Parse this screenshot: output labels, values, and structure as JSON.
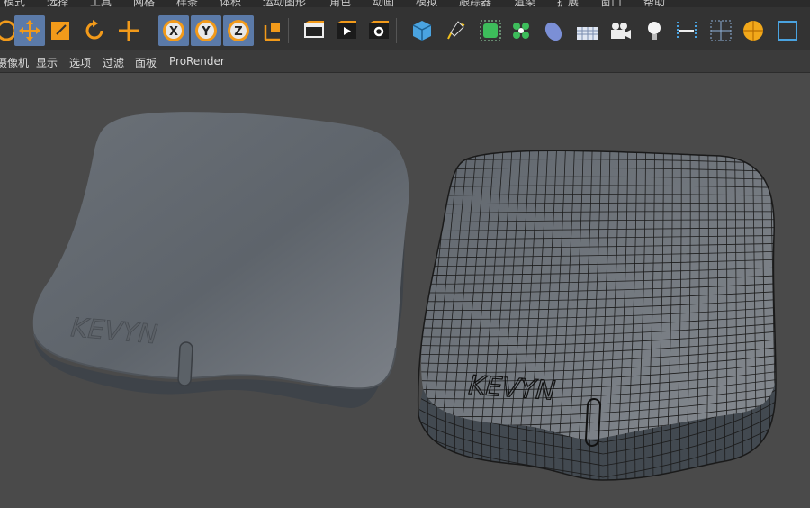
{
  "menubar": {
    "items": [
      "模式",
      "选择",
      "工具",
      "网格",
      "样条",
      "体积",
      "运动图形",
      "角色",
      "动画",
      "模拟",
      "跟踪器",
      "渲染",
      "扩展",
      "窗口",
      "帮助"
    ]
  },
  "toolbar": {
    "tools": [
      {
        "icon": "live-selection-icon",
        "active": false
      },
      {
        "icon": "move-icon",
        "active": true
      },
      {
        "icon": "scale-icon",
        "active": false
      },
      {
        "icon": "rotate-icon",
        "active": false
      },
      {
        "icon": "recent-tool-icon",
        "active": false
      },
      {
        "icon": "x-axis-lock-icon",
        "label": "X",
        "active": true
      },
      {
        "icon": "y-axis-lock-icon",
        "label": "Y",
        "active": true
      },
      {
        "icon": "z-axis-lock-icon",
        "label": "Z",
        "active": true
      },
      {
        "icon": "coordinate-system-icon",
        "active": false
      },
      {
        "icon": "render-view-icon",
        "active": false
      },
      {
        "icon": "render-picture-viewer-icon",
        "active": false
      },
      {
        "icon": "render-settings-icon",
        "active": false
      },
      {
        "icon": "cube-icon",
        "active": false
      },
      {
        "icon": "pen-spline-icon",
        "active": false
      },
      {
        "icon": "subdivision-surface-icon",
        "active": false
      },
      {
        "icon": "cloner-icon",
        "active": false
      },
      {
        "icon": "deformer-icon",
        "active": false
      },
      {
        "icon": "floor-icon",
        "active": false
      },
      {
        "icon": "camera-icon",
        "active": false
      },
      {
        "icon": "light-icon",
        "active": false
      },
      {
        "icon": "measure-icon",
        "active": false
      },
      {
        "icon": "grid-object-icon",
        "active": false
      },
      {
        "icon": "material-sphere-icon",
        "active": false
      },
      {
        "icon": "extra-icon",
        "active": false
      }
    ]
  },
  "viewbar": {
    "items": [
      "摄像机",
      "显示",
      "选项",
      "过滤",
      "面板",
      "ProRender"
    ]
  },
  "viewport": {
    "engraving_left": "KEVYN",
    "engraving_right": "KEVYN",
    "colors": {
      "background": "#4a4a4a",
      "model_top": "#656b72",
      "model_side": "#3f444a",
      "wire": "#1c1c1c"
    }
  }
}
